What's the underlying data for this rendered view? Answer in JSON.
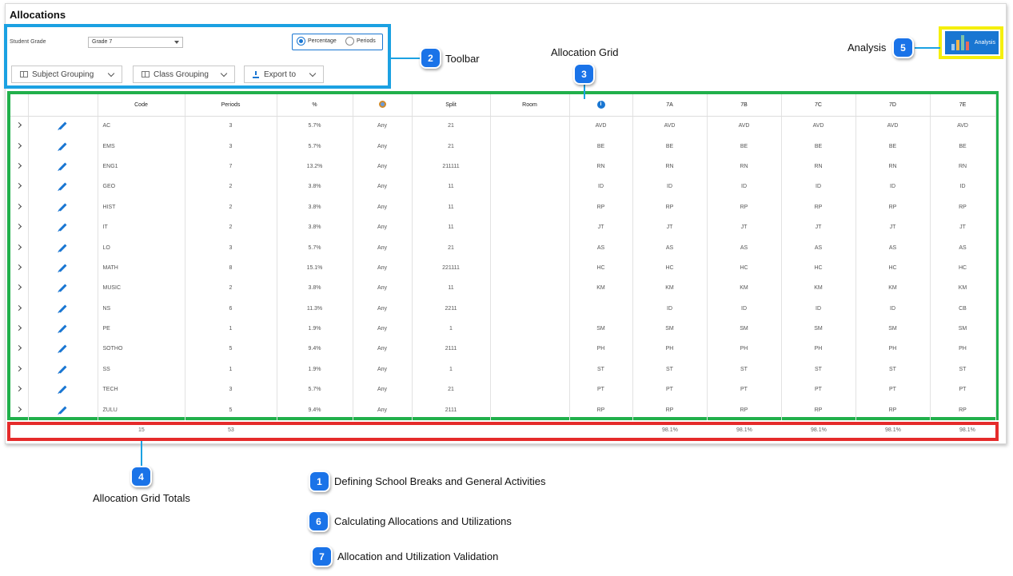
{
  "title": "Allocations",
  "toolbar": {
    "student_grade_label": "Student Grade",
    "student_grade_value": "Grade 7",
    "radio_percentage": "Percentage",
    "radio_periods": "Periods",
    "subject_grouping": "Subject Grouping",
    "class_grouping": "Class Grouping",
    "export_to": "Export to"
  },
  "analysis_button": "Analysis",
  "grid": {
    "headers": [
      "",
      "",
      "Code",
      "Periods",
      "%",
      "",
      "Split",
      "Room",
      "",
      "7A",
      "7B",
      "7C",
      "7D",
      "7E"
    ],
    "header_icons": {
      "col5": "teacher-icon",
      "col8": "info-icon"
    },
    "rows": [
      [
        "AC",
        "3",
        "5.7%",
        "Any",
        "21",
        "",
        "AVD",
        "AVD",
        "AVD",
        "AVD",
        "AVD",
        "AVD"
      ],
      [
        "EMS",
        "3",
        "5.7%",
        "Any",
        "21",
        "",
        "BE",
        "BE",
        "BE",
        "BE",
        "BE",
        "BE"
      ],
      [
        "ENG1",
        "7",
        "13.2%",
        "Any",
        "211111",
        "",
        "RN",
        "RN",
        "RN",
        "RN",
        "RN",
        "RN"
      ],
      [
        "GEO",
        "2",
        "3.8%",
        "Any",
        "11",
        "",
        "ID",
        "ID",
        "ID",
        "ID",
        "ID",
        "ID"
      ],
      [
        "HIST",
        "2",
        "3.8%",
        "Any",
        "11",
        "",
        "RP",
        "RP",
        "RP",
        "RP",
        "RP",
        "RP"
      ],
      [
        "IT",
        "2",
        "3.8%",
        "Any",
        "11",
        "",
        "JT",
        "JT",
        "JT",
        "JT",
        "JT",
        "JT"
      ],
      [
        "LO",
        "3",
        "5.7%",
        "Any",
        "21",
        "",
        "AS",
        "AS",
        "AS",
        "AS",
        "AS",
        "AS"
      ],
      [
        "MATH",
        "8",
        "15.1%",
        "Any",
        "221111",
        "",
        "HC",
        "HC",
        "HC",
        "HC",
        "HC",
        "HC"
      ],
      [
        "MUSIC",
        "2",
        "3.8%",
        "Any",
        "11",
        "",
        "KM",
        "KM",
        "KM",
        "KM",
        "KM",
        "KM"
      ],
      [
        "NS",
        "6",
        "11.3%",
        "Any",
        "2211",
        "",
        "",
        "ID",
        "ID",
        "ID",
        "ID",
        "CB"
      ],
      [
        "PE",
        "1",
        "1.9%",
        "Any",
        "1",
        "",
        "SM",
        "SM",
        "SM",
        "SM",
        "SM",
        "SM"
      ],
      [
        "SOTHO",
        "5",
        "9.4%",
        "Any",
        "2111",
        "",
        "PH",
        "PH",
        "PH",
        "PH",
        "PH",
        "PH"
      ],
      [
        "SS",
        "1",
        "1.9%",
        "Any",
        "1",
        "",
        "ST",
        "ST",
        "ST",
        "ST",
        "ST",
        "ST"
      ],
      [
        "TECH",
        "3",
        "5.7%",
        "Any",
        "21",
        "",
        "PT",
        "PT",
        "PT",
        "PT",
        "PT",
        "PT"
      ],
      [
        "ZULU",
        "5",
        "9.4%",
        "Any",
        "2111",
        "",
        "RP",
        "RP",
        "RP",
        "RP",
        "RP",
        "RP"
      ]
    ]
  },
  "totals": {
    "code": "15",
    "periods": "53",
    "c7a": "98.1%",
    "c7b": "98.1%",
    "c7c": "98.1%",
    "c7d": "98.1%",
    "c7e": "98.1%"
  },
  "callouts": {
    "c1": {
      "num": "1",
      "label": "Defining School Breaks and General Activities"
    },
    "c2": {
      "num": "2",
      "label": "Toolbar"
    },
    "c3": {
      "num": "3",
      "label": "Allocation Grid"
    },
    "c4": {
      "num": "4",
      "label": "Allocation Grid Totals"
    },
    "c5": {
      "num": "5",
      "label": "Analysis"
    },
    "c6": {
      "num": "6",
      "label": "Calculating Allocations and Utilizations"
    },
    "c7": {
      "num": "7",
      "label": "Allocation and Utilization Validation"
    }
  },
  "colors": {
    "toolbar_highlight": "#1ba1e2",
    "grid_highlight": "#21b04b",
    "totals_highlight": "#e52b2b",
    "analysis_highlight": "#f5ef0c",
    "accent": "#1976d2"
  }
}
